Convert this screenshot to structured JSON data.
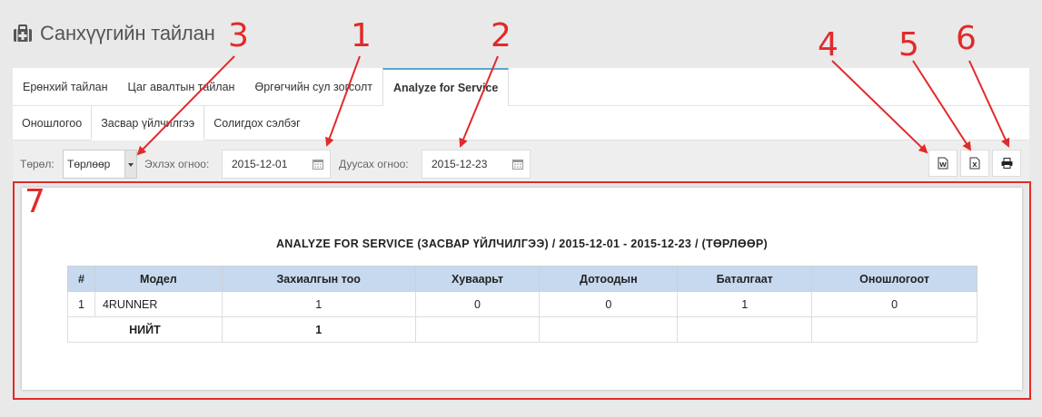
{
  "header": {
    "title": "Санхүүгийн тайлан",
    "icon": "medkit-icon"
  },
  "tabs1": [
    {
      "label": "Ерөнхий тайлан",
      "active": false
    },
    {
      "label": "Цаг авалтын тайлан",
      "active": false
    },
    {
      "label": "Өргөгчийн сул зогсолт",
      "active": false
    },
    {
      "label": "Analyze for Service",
      "active": true
    }
  ],
  "tabs2": [
    {
      "label": "Оношлогоо",
      "active": false
    },
    {
      "label": "Засвар үйлчилгээ",
      "active": true
    },
    {
      "label": "Солигдох сэлбэг",
      "active": false
    }
  ],
  "filters": {
    "type_label": "Төрөл:",
    "type_value": "Төрлөөр",
    "start_label": "Эхлэх огноо:",
    "start_value": "2015-12-01",
    "end_label": "Дуусах огноо:",
    "end_value": "2015-12-23"
  },
  "toolbar": {
    "word_icon": "word-export-icon",
    "excel_icon": "excel-export-icon",
    "print_icon": "print-icon"
  },
  "report": {
    "title": "ANALYZE FOR SERVICE (ЗАСВАР ҮЙЛЧИЛГЭЭ) / 2015-12-01 - 2015-12-23 / (ТӨРЛӨӨР)",
    "columns": [
      "#",
      "Модел",
      "Захиалгын тоо",
      "Хуваарьт",
      "Дотоодын",
      "Баталгаат",
      "Оношлогоот"
    ],
    "rows": [
      [
        "1",
        "4RUNNER",
        "1",
        "0",
        "0",
        "1",
        "0"
      ]
    ],
    "total_label": "НИЙТ",
    "total_value": "1"
  },
  "annotations": {
    "n1": "1",
    "n2": "2",
    "n3": "3",
    "n4": "4",
    "n5": "5",
    "n6": "6",
    "n7": "7",
    "color": "#e22a2a"
  },
  "colors": {
    "table_header": "#c6d9ef",
    "tab_accent": "#5ea3cf"
  }
}
